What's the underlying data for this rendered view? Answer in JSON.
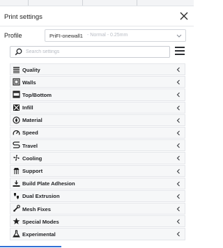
{
  "dialog": {
    "title": "Print settings"
  },
  "profile": {
    "label": "Profile",
    "name": "PriFI-onewall1",
    "subtitle": "- Normal - 0.25mm"
  },
  "search": {
    "placeholder": "Search settings"
  },
  "categories": [
    {
      "label": "Quality",
      "icon": "quality-icon"
    },
    {
      "label": "Walls",
      "icon": "walls-icon"
    },
    {
      "label": "Top/Bottom",
      "icon": "top-bottom-icon"
    },
    {
      "label": "Infill",
      "icon": "infill-icon"
    },
    {
      "label": "Material",
      "icon": "material-icon"
    },
    {
      "label": "Speed",
      "icon": "speed-icon"
    },
    {
      "label": "Travel",
      "icon": "travel-icon"
    },
    {
      "label": "Cooling",
      "icon": "cooling-icon"
    },
    {
      "label": "Support",
      "icon": "support-icon"
    },
    {
      "label": "Build Plate Adhesion",
      "icon": "build-plate-adhesion-icon"
    },
    {
      "label": "Dual Extrusion",
      "icon": "dual-extrusion-icon"
    },
    {
      "label": "Mesh Fixes",
      "icon": "mesh-fixes-icon"
    },
    {
      "label": "Special Modes",
      "icon": "special-modes-icon"
    },
    {
      "label": "Experimental",
      "icon": "experimental-icon"
    }
  ],
  "colors": {
    "accent": "#2f6fd6",
    "row_bg": "#f6f7f8",
    "row_border": "#e4e6ea",
    "text": "#1e1f22"
  }
}
